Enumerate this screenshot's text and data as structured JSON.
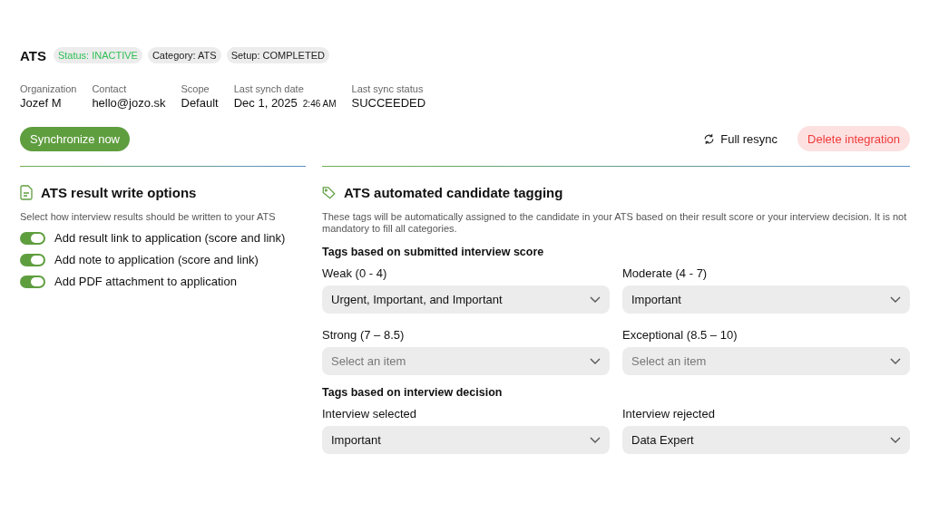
{
  "header": {
    "title": "ATS",
    "badges": [
      {
        "label": "Status: INACTIVE",
        "kind": "status"
      },
      {
        "label": "Category: ATS",
        "kind": "plain"
      },
      {
        "label": "Setup: COMPLETED",
        "kind": "plain"
      }
    ]
  },
  "details": [
    {
      "label": "Organization",
      "value": "Jozef M"
    },
    {
      "label": "Contact",
      "value": "hello@jozo.sk"
    },
    {
      "label": "Scope",
      "value": "Default"
    },
    {
      "label": "Last synch date",
      "value": "Dec 1, 2025",
      "time": "2:46 AM"
    },
    {
      "label": "Last sync status",
      "value": "SUCCEEDED"
    }
  ],
  "actions": {
    "sync": "Synchronize now",
    "resync": "Full resync",
    "delete": "Delete integration"
  },
  "write_options": {
    "title": "ATS result write options",
    "description": "Select how interview results should be written to your ATS",
    "toggles": [
      {
        "label": "Add result link to application (score and link)",
        "on": true
      },
      {
        "label": "Add note to application (score and link)",
        "on": true
      },
      {
        "label": "Add PDF attachment to application",
        "on": true
      }
    ]
  },
  "tagging": {
    "title": "ATS automated candidate tagging",
    "description": "These tags will be automatically assigned to the candidate in your ATS based on their result score or your interview decision. It is not mandatory to fill all categories.",
    "groups": [
      {
        "title": "Tags based on submitted interview score",
        "fields": [
          {
            "label": "Weak (0 - 4)",
            "value": "Urgent, Important, and Important"
          },
          {
            "label": "Moderate (4 - 7)",
            "value": "Important"
          },
          {
            "label": "Strong (7 – 8.5)",
            "placeholder": "Select an item"
          },
          {
            "label": "Exceptional (8.5 – 10)",
            "placeholder": "Select an item"
          }
        ]
      },
      {
        "title": "Tags based on interview decision",
        "fields": [
          {
            "label": "Interview selected",
            "value": "Important"
          },
          {
            "label": "Interview rejected",
            "value": "Data Expert"
          }
        ]
      }
    ]
  }
}
